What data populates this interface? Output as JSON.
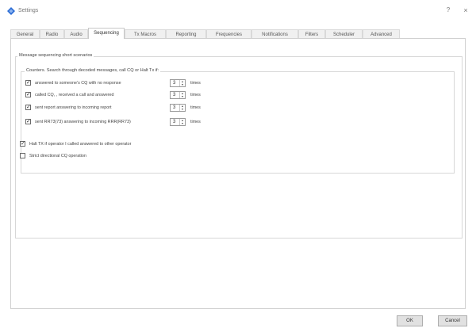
{
  "window": {
    "title": "Settings",
    "help_label": "?",
    "close_label": "×"
  },
  "tabs": [
    {
      "label": "General"
    },
    {
      "label": "Radio"
    },
    {
      "label": "Audio"
    },
    {
      "label": "Sequencing",
      "active": true
    },
    {
      "label": "Tx Macros"
    },
    {
      "label": "Reporting"
    },
    {
      "label": "Frequencies"
    },
    {
      "label": "Notifications"
    },
    {
      "label": "Filters"
    },
    {
      "label": "Scheduler"
    },
    {
      "label": "Advanced"
    }
  ],
  "sequencing": {
    "outer_group_title": "Message sequencing short scenarios",
    "inner_group_title": "Counters. Search through decoded messages, call CQ or Halt Tx if:",
    "counters": [
      {
        "label": "answered to someone's CQ with no response",
        "checked": true,
        "value": "3",
        "unit": "times"
      },
      {
        "label": "called CQ, , received a call and answered",
        "checked": true,
        "value": "3",
        "unit": "times"
      },
      {
        "label": "sent report answering to incoming report",
        "checked": true,
        "value": "3",
        "unit": "times"
      },
      {
        "label": "sent RR73(73) answering to incoming RRR(RR73)",
        "checked": true,
        "value": "3",
        "unit": "times"
      }
    ],
    "options": [
      {
        "label": "Halt TX if operator I called answered to other operator",
        "checked": true
      },
      {
        "label": "Strict directional CQ operation",
        "checked": false
      }
    ]
  },
  "buttons": {
    "ok_label": "OK",
    "cancel_label": "Cancel"
  },
  "colors": {
    "accent": "#2f6fd6",
    "panel_border": "#d0d0d0"
  }
}
